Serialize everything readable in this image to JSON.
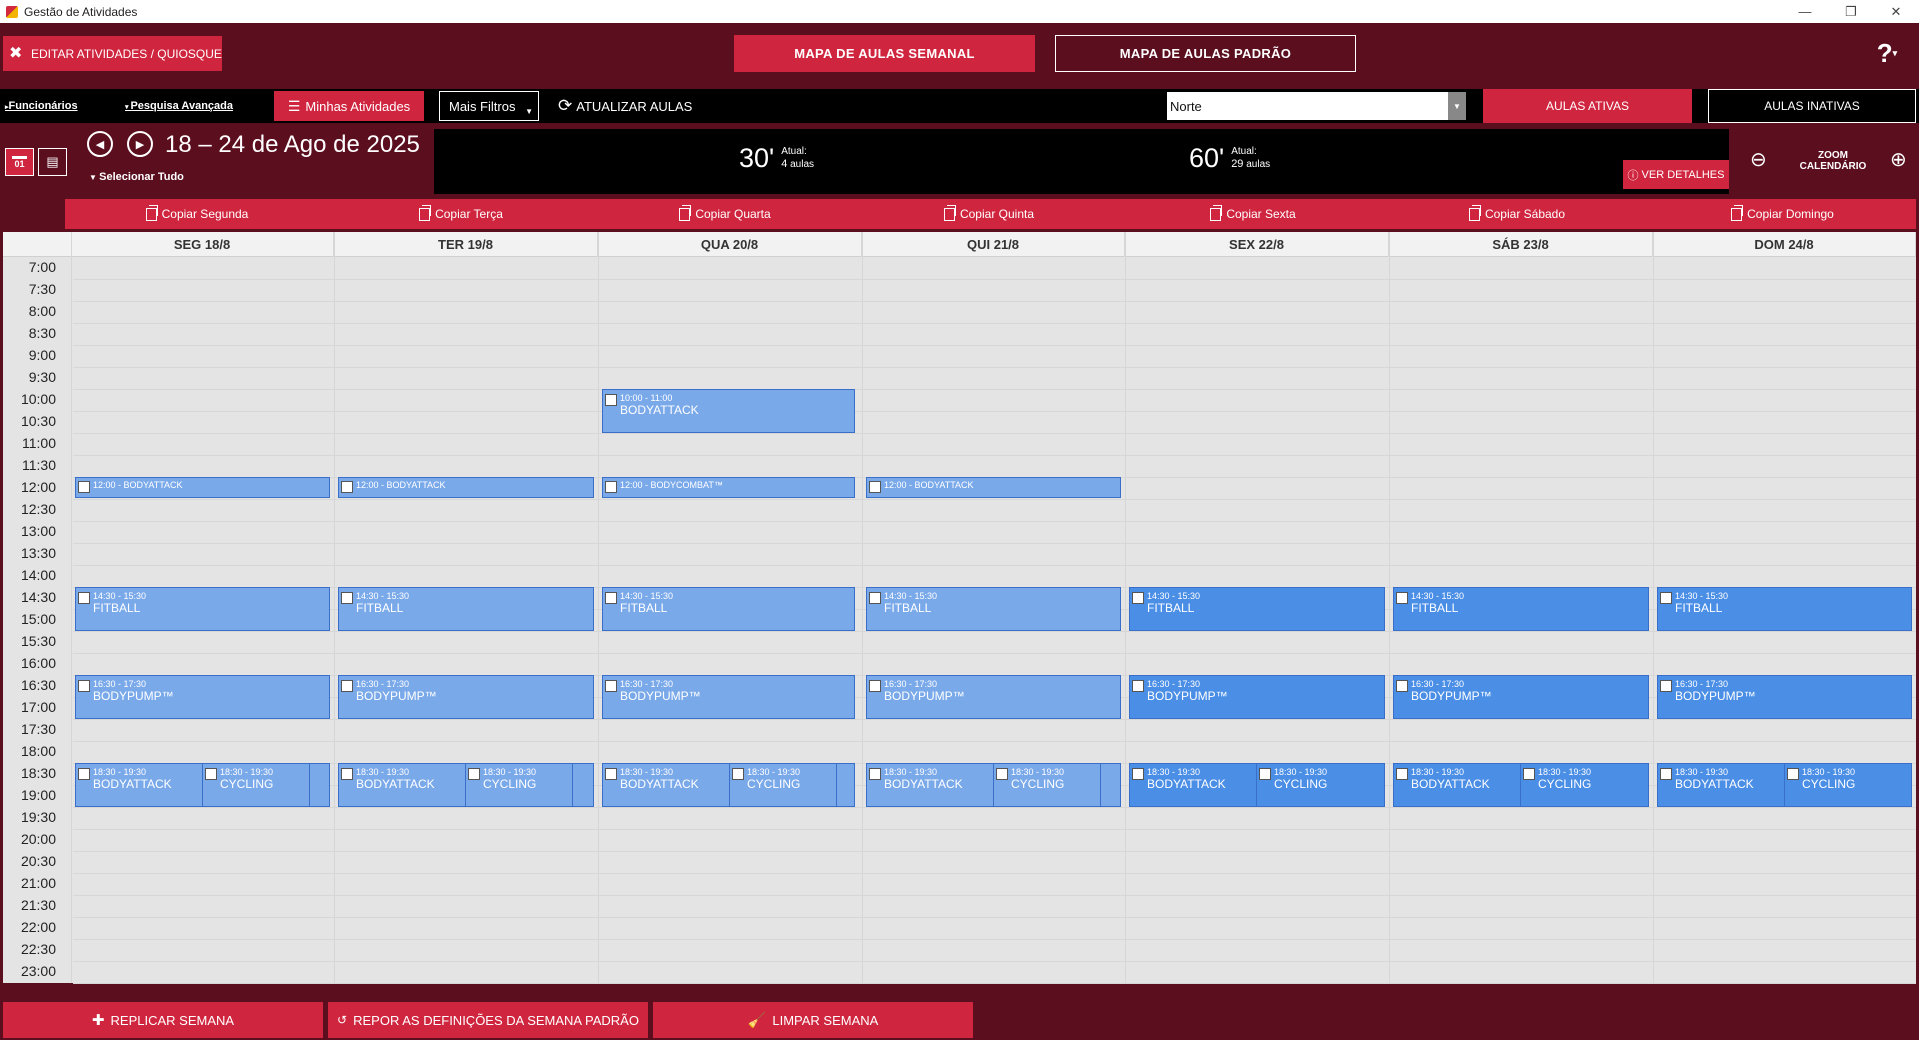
{
  "window": {
    "title": "Gestão de Atividades",
    "minimize": "—",
    "restore": "❐",
    "close": "✕"
  },
  "header": {
    "edit_label": "EDITAR ATIVIDADES / QUIOSQUE",
    "mapa_semanal": "MAPA DE AULAS SEMANAL",
    "mapa_padrao": "MAPA DE AULAS PADRÃO",
    "help": "?"
  },
  "filters": {
    "funcionarios": "Funcionários",
    "pesquisa": "Pesquisa Avançada",
    "minhas": "Minhas Atividades",
    "mais": "Mais Filtros",
    "atualizar": "ATUALIZAR AULAS",
    "region": "Norte",
    "ativas": "AULAS ATIVAS",
    "inativas": "AULAS INATIVAS"
  },
  "nav": {
    "date_range": "18 – 24 de Ago de 2025",
    "select_all": "Selecionar Tudo",
    "cal_day": "01"
  },
  "stats": {
    "s30_big": "30'",
    "s30_label": "Atual:",
    "s30_value": "4",
    "s30_unit": "aulas",
    "s60_big": "60'",
    "s60_label": "Atual:",
    "s60_value": "29",
    "s60_unit": "aulas",
    "ver_detalhes": "VER DETALHES"
  },
  "zoom": {
    "line1": "ZOOM",
    "line2": "CALENDÁRIO"
  },
  "copy_buttons": [
    "Copiar Segunda",
    "Copiar Terça",
    "Copiar Quarta",
    "Copiar Quinta",
    "Copiar Sexta",
    "Copiar Sábado",
    "Copiar Domingo"
  ],
  "days": [
    "SEG 18/8",
    "TER 19/8",
    "QUA 20/8",
    "QUI 21/8",
    "SEX 22/8",
    "SÁB 23/8",
    "DOM 24/8"
  ],
  "times": [
    "7:00",
    "7:30",
    "8:00",
    "8:30",
    "9:00",
    "9:30",
    "10:00",
    "10:30",
    "11:00",
    "11:30",
    "12:00",
    "12:30",
    "13:00",
    "13:30",
    "14:00",
    "14:30",
    "15:00",
    "15:30",
    "16:00",
    "16:30",
    "17:00",
    "17:30",
    "18:00",
    "18:30",
    "19:00",
    "19:30",
    "20:00",
    "20:30",
    "21:00",
    "21:30",
    "22:00",
    "22:30",
    "23:00"
  ],
  "events": {
    "qua_1000_time": "10:00 - 11:00",
    "qua_1000_name": "BODYATTACK",
    "seg_1200": "12:00  - BODYATTACK",
    "ter_1200": "12:00  - BODYATTACK",
    "qua_1200": "12:00  - BODYCOMBAT™",
    "qui_1200": "12:00  - BODYATTACK",
    "fitball_time": "14:30 - 15:30",
    "fitball_name": "FITBALL",
    "pump_time": "16:30 - 17:30",
    "pump_name": "BODYPUMP™",
    "evening_time": "18:30 - 19:30",
    "attack_name": "BODYATTACK",
    "cycling_name": "CYCLING"
  },
  "footer": {
    "replicar": "REPLICAR SEMANA",
    "repor": "REPOR AS DEFINIÇÕES DA SEMANA PADRÃO",
    "limpar": "LIMPAR SEMANA"
  },
  "colors": {
    "brand": "#d0253f",
    "background": "#5a0e1e",
    "event_light": "#7aa9ea",
    "event_dark": "#4a8ee6"
  }
}
